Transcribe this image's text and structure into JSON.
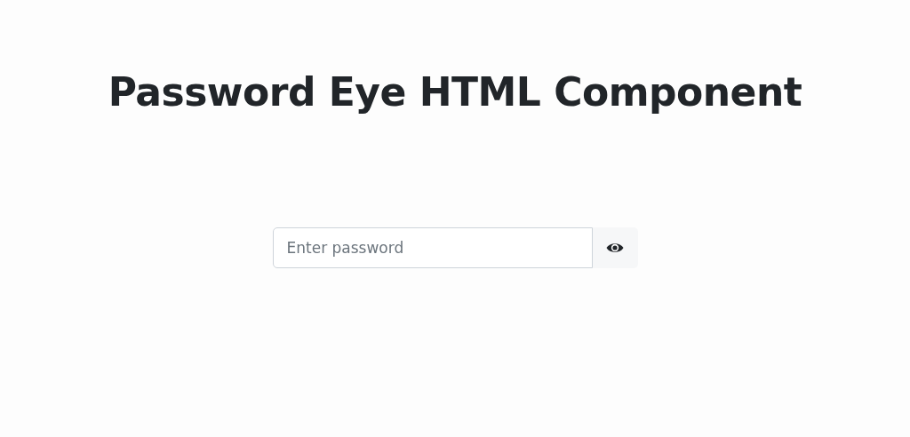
{
  "title": "Password Eye HTML Component",
  "password_field": {
    "placeholder": "Enter password"
  }
}
